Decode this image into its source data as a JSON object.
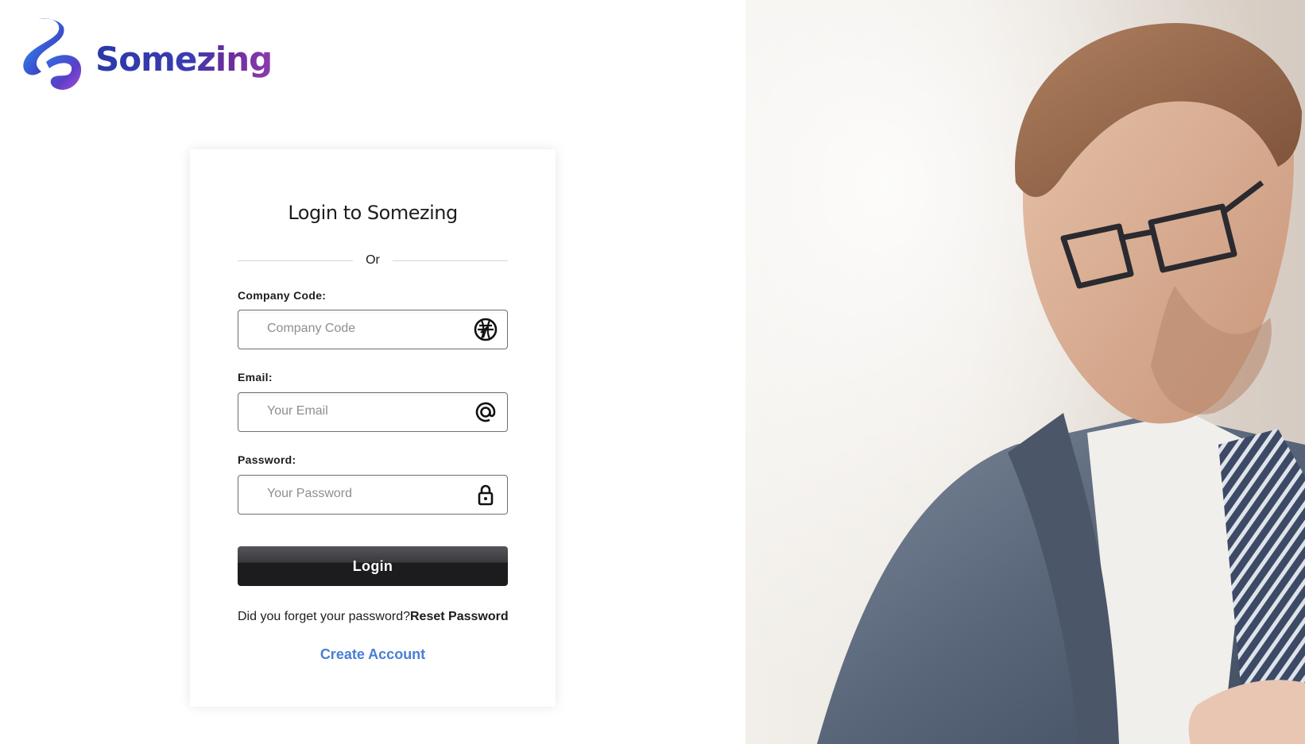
{
  "brand": {
    "name": "Somezing"
  },
  "login": {
    "title": "Login to Somezing",
    "divider_text": "Or",
    "company": {
      "label": "Company Code:",
      "placeholder": "Company Code",
      "value": "",
      "icon": "globe-icon"
    },
    "email": {
      "label": "Email:",
      "placeholder": "Your Email",
      "value": "",
      "icon": "at-sign-icon"
    },
    "password": {
      "label": "Password:",
      "placeholder": "Your Password",
      "value": "",
      "icon": "lock-icon"
    },
    "submit_label": "Login",
    "forgot_text": "Did you forget your password?",
    "reset_label": "Reset Password",
    "create_label": "Create Account"
  },
  "colors": {
    "accent_link": "#4a7ed6",
    "button_dark": "#1c1c1f",
    "brand_blue": "#2a3aa8",
    "brand_purple": "#7a3aa8"
  },
  "hero": {
    "description_icon": "businessman-photo"
  }
}
